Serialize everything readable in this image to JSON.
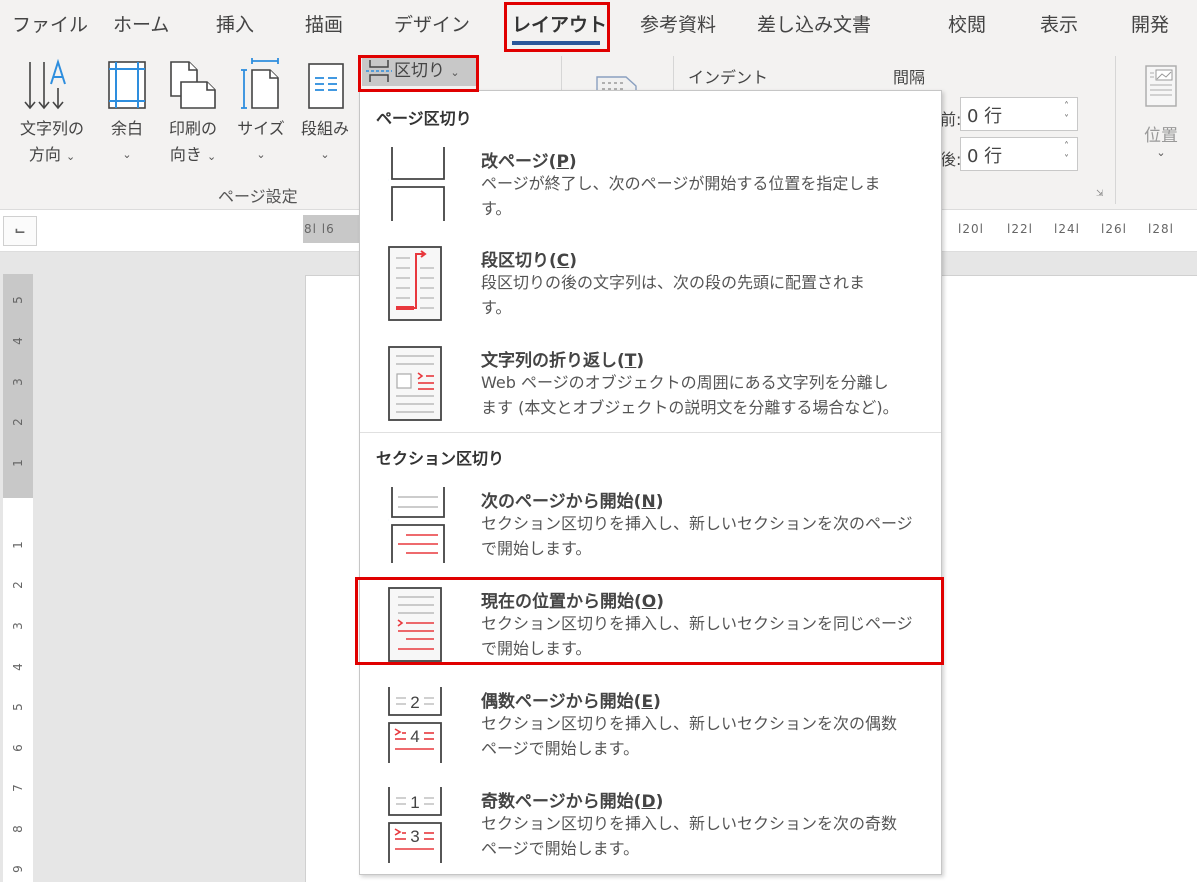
{
  "tabs": [
    {
      "label": "ファイル",
      "active": false
    },
    {
      "label": "ホーム",
      "active": false
    },
    {
      "label": "挿入",
      "active": false
    },
    {
      "label": "描画",
      "active": false
    },
    {
      "label": "デザイン",
      "active": false
    },
    {
      "label": "レイアウト",
      "active": true
    },
    {
      "label": "参考資料",
      "active": false
    },
    {
      "label": "差し込み文書",
      "active": false
    },
    {
      "label": "校閲",
      "active": false
    },
    {
      "label": "表示",
      "active": false
    },
    {
      "label": "開発",
      "active": false
    }
  ],
  "ribbon": {
    "page_setup": {
      "group_label": "ページ設定",
      "buttons": [
        {
          "line1": "文字列の",
          "line2": "方向",
          "icon": "text-direction-icon"
        },
        {
          "line1": "余白",
          "line2": "",
          "icon": "margins-icon"
        },
        {
          "line1": "印刷の",
          "line2": "向き",
          "icon": "orientation-icon"
        },
        {
          "line1": "サイズ",
          "line2": "",
          "icon": "size-icon"
        },
        {
          "line1": "段組み",
          "line2": "",
          "icon": "columns-icon"
        }
      ],
      "breaks_label": "区切り"
    },
    "paragraph": {
      "indent_label": "インデント",
      "spacing_label": "間隔",
      "before_label": "前:",
      "after_label": "後:",
      "before_value": "0 行",
      "after_value": "0 行"
    },
    "arrange": {
      "position_label": "位置"
    }
  },
  "ruler": {
    "h_ticks_left": "8l  l6",
    "h_ticks_right": [
      "l20l",
      "l22l",
      "l24l",
      "l26l",
      "l28l"
    ],
    "v_ticks_gray": [
      "5",
      "4",
      "3",
      "2",
      "1"
    ],
    "v_ticks_white": [
      "1",
      "2",
      "3",
      "4",
      "5",
      "6",
      "7",
      "8",
      "9"
    ]
  },
  "menu": {
    "page_breaks_header": "ページ区切り",
    "section_breaks_header": "セクション区切り",
    "items": [
      {
        "title": "改ページ",
        "key": "P",
        "desc": [
          "ページが終了し、次のページが開始する位置を指定しま",
          "す。"
        ],
        "icon": "page-break-icon"
      },
      {
        "title": "段区切り",
        "key": "C",
        "desc": [
          "段区切りの後の文字列は、次の段の先頭に配置されま",
          "す。"
        ],
        "icon": "column-break-icon"
      },
      {
        "title": "文字列の折り返し",
        "key": "T",
        "desc": [
          "Web ページのオブジェクトの周囲にある文字列を分離し",
          "ます (本文とオブジェクトの説明文を分離する場合など)。"
        ],
        "icon": "text-wrapping-icon"
      },
      {
        "title": "次のページから開始",
        "key": "N",
        "desc": [
          "セクション区切りを挿入し、新しいセクションを次のページ",
          "で開始します。"
        ],
        "icon": "next-page-section-icon"
      },
      {
        "title": "現在の位置から開始",
        "key": "O",
        "desc": [
          "セクション区切りを挿入し、新しいセクションを同じページ",
          "で開始します。"
        ],
        "icon": "continuous-section-icon",
        "highlighted": true
      },
      {
        "title": "偶数ページから開始",
        "key": "E",
        "desc": [
          "セクション区切りを挿入し、新しいセクションを次の偶数",
          "ページで開始します。"
        ],
        "icon": "even-page-section-icon",
        "numbers": [
          "2",
          "4"
        ]
      },
      {
        "title": "奇数ページから開始",
        "key": "D",
        "desc": [
          "セクション区切りを挿入し、新しいセクションを次の奇数",
          "ページで開始します。"
        ],
        "icon": "odd-page-section-icon",
        "numbers": [
          "1",
          "3"
        ]
      }
    ]
  },
  "colors": {
    "accent_blue": "#2b579a",
    "highlight_red": "#e00000",
    "icon_red": "#e8383d",
    "icon_blue": "#2e8ede"
  }
}
